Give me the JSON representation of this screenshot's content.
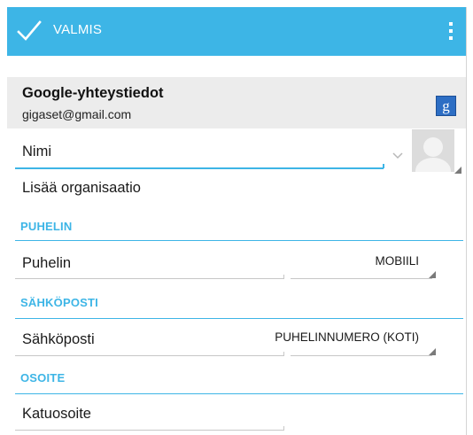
{
  "action_bar": {
    "done_label": "VALMIS",
    "check_icon": "check-icon",
    "overflow_icon": "overflow-menu-icon",
    "color": "#3db5e6"
  },
  "account": {
    "title": "Google-yhteystiedot",
    "email": "gigaset@gmail.com",
    "icon_letter": "g"
  },
  "name_field": {
    "placeholder": "Nimi",
    "expand_icon": "chevron-down-icon"
  },
  "organisation_link": "Lisää organisaatio",
  "sections": {
    "phone": {
      "header": "PUHELIN",
      "field_placeholder": "Puhelin",
      "type": "MOBIILI"
    },
    "email": {
      "header": "SÄHKÖPOSTI",
      "field_placeholder": "Sähköposti",
      "type": "PUHELINNUMERO (KOTI)"
    },
    "address": {
      "header": "OSOITE",
      "field_placeholder": "Katuosoite"
    }
  }
}
